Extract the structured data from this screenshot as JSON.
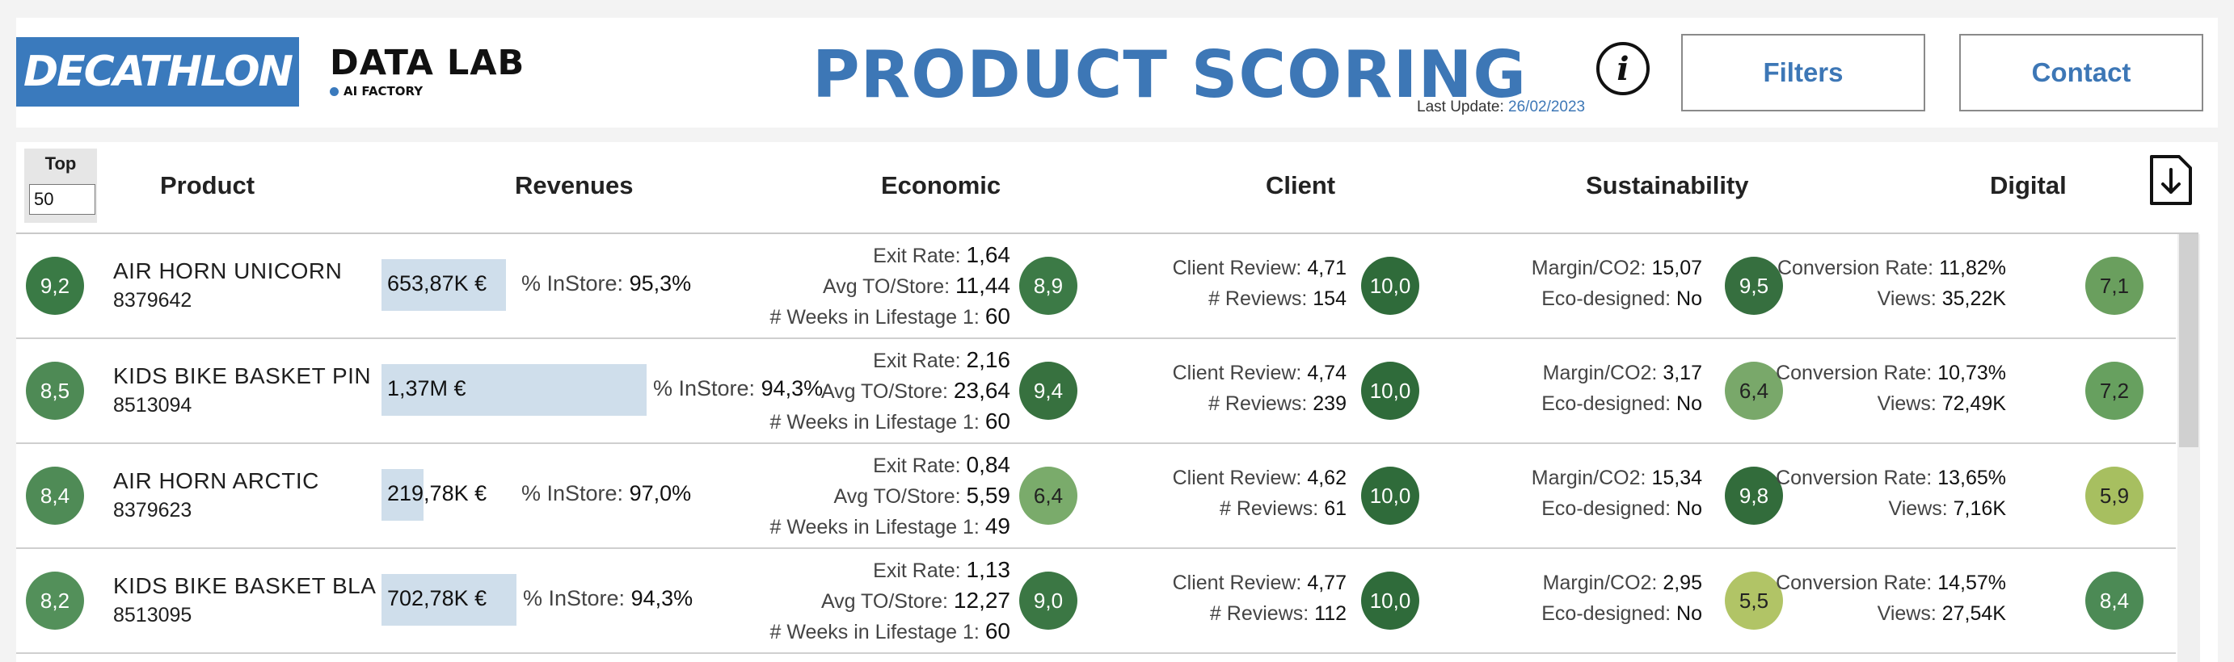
{
  "header": {
    "logo": "DECATHLON",
    "brand_title": "DATA LAB",
    "brand_subtitle": "AI FACTORY",
    "page_title": "PRODUCT SCORING",
    "last_update_label": "Last Update:",
    "last_update_date": "26/02/2023",
    "filters_label": "Filters",
    "contact_label": "Contact",
    "info_icon": "info-icon"
  },
  "table": {
    "top_label": "Top",
    "top_value": "50",
    "columns": {
      "product": "Product",
      "revenues": "Revenues",
      "economic": "Economic",
      "client": "Client",
      "sustainability": "Sustainability",
      "digital": "Digital"
    },
    "export_icon": "download-file-icon",
    "labels": {
      "in_store": "% InStore:",
      "exit_rate": "Exit Rate:",
      "avg_to": "Avg TO/Store:",
      "weeks": "# Weeks in Lifestage 1:",
      "client_review": "Client Review:",
      "reviews": "# Reviews:",
      "margin": "Margin/CO2:",
      "eco": "Eco-designed:",
      "conversion": "Conversion Rate:",
      "views": "Views:"
    },
    "rows": [
      {
        "score": "9,2",
        "score_color": "#3a7a45",
        "name": "AIR HORN UNICORN",
        "id": "8379642",
        "revenue": "653,87K €",
        "revenue_share": 0.47,
        "in_store": "95,3%",
        "exit_rate": "1,64",
        "avg_to": "11,44",
        "weeks": "60",
        "economic_score": "8,9",
        "economic_color": "#3c7a46",
        "client_review": "4,71",
        "reviews": "154",
        "client_score": "10,0",
        "client_color": "#2f6b3a",
        "margin": "15,07",
        "eco": "No",
        "sustain_score": "9,5",
        "sustain_color": "#366f3f",
        "conversion": "11,82%",
        "views": "35,22K",
        "digital_score": "7,1",
        "digital_color": "#6a9f5e"
      },
      {
        "score": "8,5",
        "score_color": "#4e8a55",
        "name": "KIDS BIKE BASKET PIN",
        "id": "8513094",
        "revenue": "1,37M €",
        "revenue_share": 1.0,
        "in_store": "94,3%",
        "exit_rate": "2,16",
        "avg_to": "23,64",
        "weeks": "60",
        "economic_score": "9,4",
        "economic_color": "#37713f",
        "client_review": "4,74",
        "reviews": "239",
        "client_score": "10,0",
        "client_color": "#2f6b3a",
        "margin": "3,17",
        "eco": "No",
        "sustain_score": "6,4",
        "sustain_color": "#79a86a",
        "conversion": "10,73%",
        "views": "72,49K",
        "digital_score": "7,2",
        "digital_color": "#67a05f"
      },
      {
        "score": "8,4",
        "score_color": "#4f8b56",
        "name": "AIR HORN ARCTIC",
        "id": "8379623",
        "revenue": "219,78K €",
        "revenue_share": 0.16,
        "in_store": "97,0%",
        "exit_rate": "0,84",
        "avg_to": "5,59",
        "weeks": "49",
        "economic_score": "6,4",
        "economic_color": "#7aab6b",
        "client_review": "4,62",
        "reviews": "61",
        "client_score": "10,0",
        "client_color": "#2f6b3a",
        "margin": "15,34",
        "eco": "No",
        "sustain_score": "9,8",
        "sustain_color": "#326c3b",
        "conversion": "13,65%",
        "views": "7,16K",
        "digital_score": "5,9",
        "digital_color": "#a7bf60"
      },
      {
        "score": "8,2",
        "score_color": "#53905a",
        "name": "KIDS BIKE BASKET BLA",
        "id": "8513095",
        "revenue": "702,78K €",
        "revenue_share": 0.51,
        "in_store": "94,3%",
        "exit_rate": "1,13",
        "avg_to": "12,27",
        "weeks": "60",
        "economic_score": "9,0",
        "economic_color": "#3b7744",
        "client_review": "4,77",
        "reviews": "112",
        "client_score": "10,0",
        "client_color": "#2f6b3a",
        "margin": "2,95",
        "eco": "No",
        "sustain_score": "5,5",
        "sustain_color": "#b1c466",
        "conversion": "14,57%",
        "views": "27,54K",
        "digital_score": "8,4",
        "digital_color": "#4c8a55"
      }
    ]
  }
}
